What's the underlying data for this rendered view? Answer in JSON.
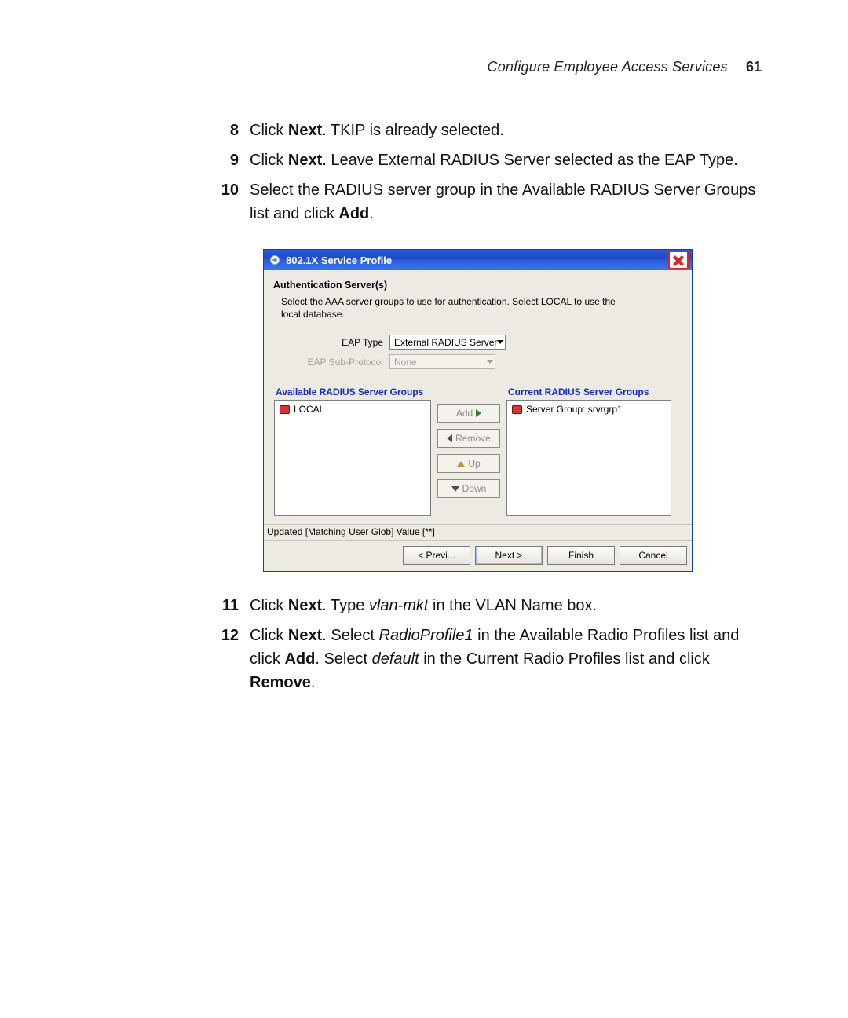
{
  "header": {
    "section": "Configure Employee Access Services",
    "page_number": "61"
  },
  "steps_a": [
    {
      "n": "8",
      "html": "Click <b>Next</b>. TKIP is already selected."
    },
    {
      "n": "9",
      "html": "Click <b>Next</b>. Leave External RADIUS Server selected as the EAP Type."
    },
    {
      "n": "10",
      "html": "Select the RADIUS server group in the Available RADIUS Server Groups list and click <b>Add</b>."
    }
  ],
  "dialog": {
    "title": "802.1X Service Profile",
    "heading": "Authentication Server(s)",
    "description": "Select the AAA server groups to use for authentication. Select LOCAL to use the local database.",
    "fields": {
      "eap_type_label": "EAP Type",
      "eap_type_value": "External RADIUS Server",
      "eap_sub_label": "EAP Sub-Protocol",
      "eap_sub_value": "None"
    },
    "available_title": "Available RADIUS Server Groups",
    "available_items": [
      "LOCAL"
    ],
    "current_title": "Current RADIUS Server Groups",
    "current_items": [
      "Server Group: srvrgrp1"
    ],
    "mid_buttons": {
      "add": "Add",
      "remove": "Remove",
      "up": "Up",
      "down": "Down"
    },
    "status": "Updated [Matching User Glob] Value [**]",
    "wizard": {
      "prev": "< Previ...",
      "next": "Next >",
      "finish": "Finish",
      "cancel": "Cancel"
    }
  },
  "steps_b": [
    {
      "n": "11",
      "html": "Click <b>Next</b>. Type <i>vlan-mkt</i> in the VLAN Name box."
    },
    {
      "n": "12",
      "html": "Click <b>Next</b>. Select <i>RadioProfile1</i> in the Available Radio Profiles list and click <b>Add</b>. Select <i>default</i> in the Current Radio Profiles list and click <b>Remove</b>."
    }
  ]
}
